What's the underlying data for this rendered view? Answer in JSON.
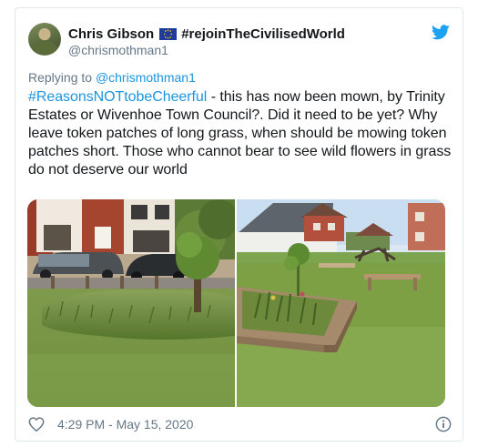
{
  "tweet": {
    "display_name": "Chris Gibson",
    "flag_icon": "eu-flag-icon",
    "name_hashtag": "#rejoinTheCivilisedWorld",
    "handle": "@chrismothman1",
    "replying_prefix": "Replying to ",
    "replying_handle": "@chrismothman1",
    "body_hashtag": "#ReasonsNOTtobeCheerful",
    "body_text": " - this has now been mown, by Trinity Estates or Wivenhoe Town Council?. Did it need to be yet? Why leave token patches of long grass, when should be mowing token patches short. Those who cannot bear to see wild flowers in grass do not deserve our world",
    "timestamp": "4:29 PM - May 15, 2020"
  },
  "icons": {
    "brand": "twitter-bird-icon",
    "like": "heart-icon",
    "info": "info-icon"
  },
  "colors": {
    "link": "#1b95e0",
    "brand": "#1da1f2",
    "muted": "#657786",
    "text": "#14171a"
  }
}
